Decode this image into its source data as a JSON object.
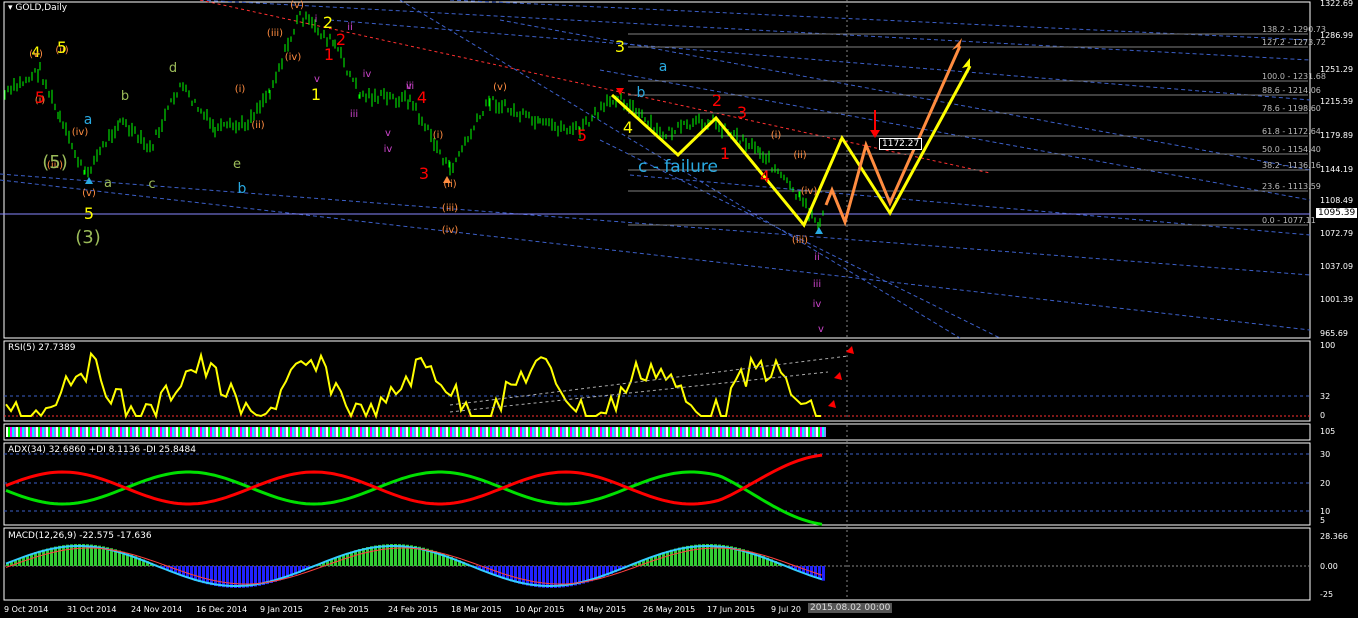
{
  "window": {
    "symbol_title": "GOLD,Daily",
    "rsi_title": "RSI(5) 27.7389",
    "adx_title": "ADX(34) 32.6860 +DI 8.1136 -DI 25.8484",
    "macd_title": "MACD(12,26,9) -22.575 -17.636",
    "crosshair_time": "2015.08.02 00:00"
  },
  "colors": {
    "background": "#000000",
    "bar": "#00ff00",
    "yellow": "#ffff00",
    "orange": "#ff8c40",
    "red": "#ff0000",
    "cyan": "#29a9e0",
    "grid_dashed": "#3c5fc8",
    "fib_line": "#808080",
    "adx_green": "#00e000",
    "adx_red": "#ff0000",
    "macd_hist_pos": "#33cc33",
    "macd_hist_neg": "#2222ff",
    "macd_signal": "#ff4040",
    "macd_line": "#33ccff"
  },
  "price_axis": [
    "1322.69",
    "1286.99",
    "1251.29",
    "1215.59",
    "1179.89",
    "1144.19",
    "1108.49",
    "1072.79",
    "1037.09",
    "1001.39",
    "965.69"
  ],
  "current_price": "1095.39",
  "marker_price": "1172.27",
  "rsi_axis": [
    "100",
    "32",
    "0"
  ],
  "adx_axis": [
    "30",
    "20",
    "10",
    "5"
  ],
  "macd_axis": [
    "28.366",
    "0.00",
    "-25"
  ],
  "strip_axis": "105",
  "time_axis": [
    "9 Oct 2014",
    "31 Oct 2014",
    "24 Nov 2014",
    "16 Dec 2014",
    "9 Jan 2015",
    "2 Feb 2015",
    "24 Feb 2015",
    "18 Mar 2015",
    "10 Apr 2015",
    "4 May 2015",
    "26 May 2015",
    "17 Jun 2015",
    "9 Jul 20"
  ],
  "fib_levels": [
    "138.2 - 1290.73",
    "127.2 - 1273.72",
    "100.0 - 1231.68",
    "88.6 - 1214.06",
    "78.6 - 1198.60",
    "61.8 - 1172.64",
    "50.0 - 1154.40",
    "38.2 - 1136.16",
    "23.6 - 1113.59",
    "0.0 - 1077.11"
  ],
  "annotations": [
    {
      "text": "4",
      "color": "#ffff00",
      "size": 14
    },
    {
      "text": "(i)",
      "color": "#ff8c40",
      "size": 10
    },
    {
      "text": "(ii)",
      "color": "#ff8c40",
      "size": 10
    },
    {
      "text": "(iii)",
      "color": "#ff8c40",
      "size": 10
    },
    {
      "text": "(iv)",
      "color": "#ff8c40",
      "size": 10
    },
    {
      "text": "(v)",
      "color": "#ff8c40",
      "size": 10
    },
    {
      "text": "a",
      "color": "#29a9e0",
      "size": 14
    },
    {
      "text": "a",
      "color": "#9bbb59",
      "size": 13
    },
    {
      "text": "b",
      "color": "#9bbb59",
      "size": 13
    },
    {
      "text": "c",
      "color": "#9bbb59",
      "size": 13
    },
    {
      "text": "d",
      "color": "#9bbb59",
      "size": 13
    },
    {
      "text": "e",
      "color": "#9bbb59",
      "size": 13
    },
    {
      "text": "b",
      "color": "#29a9e0",
      "size": 14
    },
    {
      "text": "5",
      "color": "#ffff00",
      "size": 16
    },
    {
      "text": "(3)",
      "color": "#9bbb59",
      "size": 18
    },
    {
      "text": "(i)",
      "color": "#ff8c40",
      "size": 10
    },
    {
      "text": "(ii)",
      "color": "#ff8c40",
      "size": 10
    },
    {
      "text": "(iii)",
      "color": "#ff8c40",
      "size": 10
    },
    {
      "text": "(iv)",
      "color": "#ff8c40",
      "size": 10
    },
    {
      "text": "(v)",
      "color": "#ff8c40",
      "size": 10
    },
    {
      "text": "2",
      "color": "#ffff00",
      "size": 16
    },
    {
      "text": "1",
      "color": "#ffff00",
      "size": 16
    },
    {
      "text": "1",
      "color": "#ff0000",
      "size": 16
    },
    {
      "text": "2",
      "color": "#ff0000",
      "size": 16
    },
    {
      "text": "i",
      "color": "#cc44cc",
      "size": 10
    },
    {
      "text": "ii",
      "color": "#cc44cc",
      "size": 10
    },
    {
      "text": "iii",
      "color": "#cc44cc",
      "size": 10
    },
    {
      "text": "iv",
      "color": "#cc44cc",
      "size": 10
    },
    {
      "text": "v",
      "color": "#cc44cc",
      "size": 10
    },
    {
      "text": "v",
      "color": "#cc44cc",
      "size": 10
    },
    {
      "text": "iii",
      "color": "#cc44cc",
      "size": 10
    },
    {
      "text": "iv",
      "color": "#cc44cc",
      "size": 10
    },
    {
      "text": "v",
      "color": "#cc44cc",
      "size": 10
    },
    {
      "text": "4",
      "color": "#ff0000",
      "size": 16
    },
    {
      "text": "3",
      "color": "#ff0000",
      "size": 16
    },
    {
      "text": "(i)",
      "color": "#ff8c40",
      "size": 10
    },
    {
      "text": "(ii)",
      "color": "#ff8c40",
      "size": 10
    },
    {
      "text": "(iii)",
      "color": "#ff8c40",
      "size": 10
    },
    {
      "text": "(iv)",
      "color": "#ff8c40",
      "size": 10
    },
    {
      "text": "(v)",
      "color": "#ff8c40",
      "size": 10
    },
    {
      "text": "5",
      "color": "#ff0000",
      "size": 16
    },
    {
      "text": "3",
      "color": "#ffff00",
      "size": 16
    },
    {
      "text": "a",
      "color": "#29a9e0",
      "size": 14
    },
    {
      "text": "b",
      "color": "#29a9e0",
      "size": 14
    },
    {
      "text": "4",
      "color": "#ffff00",
      "size": 16
    },
    {
      "text": "c - failure",
      "color": "#29a9e0",
      "size": 17
    },
    {
      "text": "2",
      "color": "#ff0000",
      "size": 16
    },
    {
      "text": "1",
      "color": "#ff0000",
      "size": 16
    },
    {
      "text": "3",
      "color": "#ff0000",
      "size": 16
    },
    {
      "text": "4",
      "color": "#ff0000",
      "size": 16
    },
    {
      "text": "(i)",
      "color": "#ff8c40",
      "size": 10
    },
    {
      "text": "(ii)",
      "color": "#ff8c40",
      "size": 10
    },
    {
      "text": "(iii)",
      "color": "#ff8c40",
      "size": 10
    },
    {
      "text": "(iv)",
      "color": "#ff8c40",
      "size": 10
    },
    {
      "text": "ii",
      "color": "#cc44cc",
      "size": 10
    },
    {
      "text": "iii",
      "color": "#cc44cc",
      "size": 10
    },
    {
      "text": "iv",
      "color": "#cc44cc",
      "size": 10
    },
    {
      "text": "v",
      "color": "#cc44cc",
      "size": 10
    },
    {
      "text": "(v)",
      "color": "#ff8c40",
      "size": 10
    },
    {
      "text": "5",
      "color": "#ff0000",
      "size": 16
    },
    {
      "text": "5",
      "color": "#ffff00",
      "size": 16
    },
    {
      "text": "(5)",
      "color": "#9bbb59",
      "size": 18
    }
  ]
}
